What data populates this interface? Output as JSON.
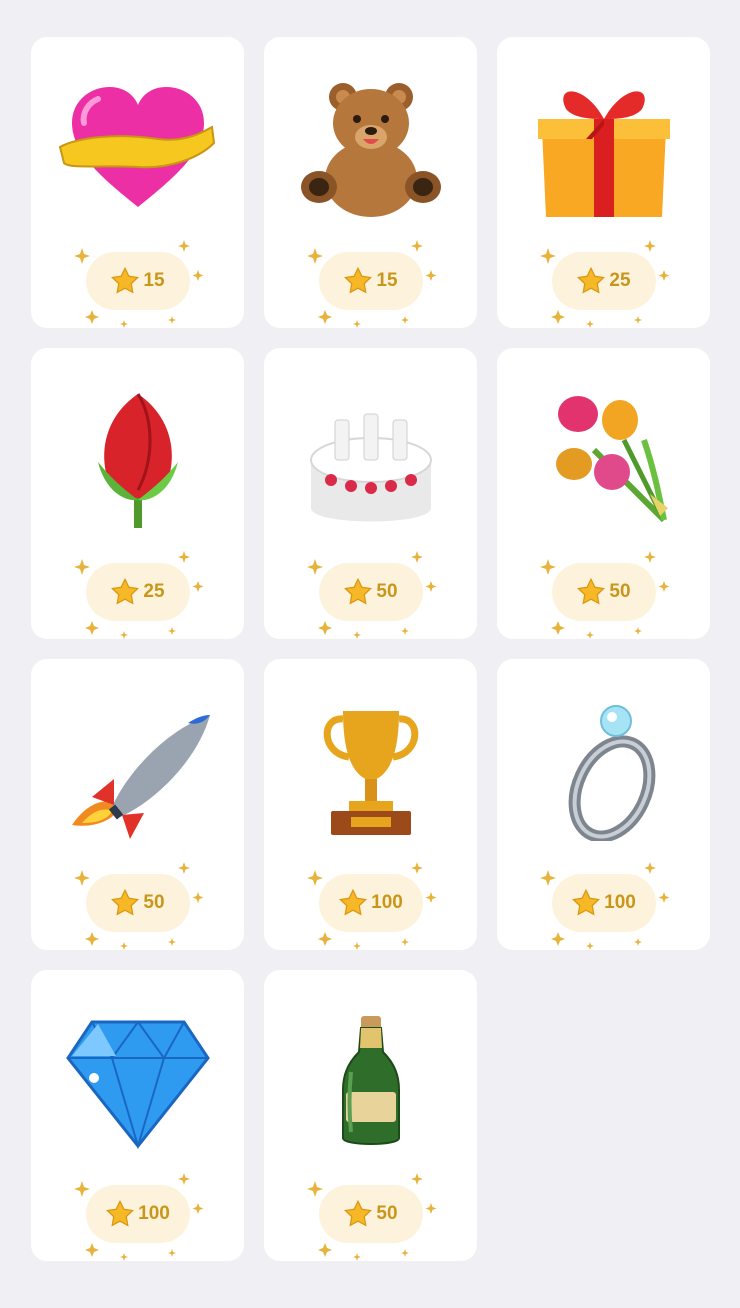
{
  "gifts": [
    {
      "icon": "heart-ribbon-icon",
      "price": "15"
    },
    {
      "icon": "teddy-bear-icon",
      "price": "15"
    },
    {
      "icon": "gift-box-icon",
      "price": "25"
    },
    {
      "icon": "rose-icon",
      "price": "25"
    },
    {
      "icon": "birthday-cake-icon",
      "price": "50"
    },
    {
      "icon": "bouquet-icon",
      "price": "50"
    },
    {
      "icon": "rocket-icon",
      "price": "50"
    },
    {
      "icon": "trophy-icon",
      "price": "100"
    },
    {
      "icon": "diamond-ring-icon",
      "price": "100"
    },
    {
      "icon": "diamond-icon",
      "price": "100"
    },
    {
      "icon": "champagne-bottle-icon",
      "price": "50"
    }
  ],
  "colors": {
    "background": "#efeff4",
    "card": "#ffffff",
    "price_pill": "#fdf3dd",
    "price_text": "#c8961a",
    "star": "#f6b826"
  }
}
